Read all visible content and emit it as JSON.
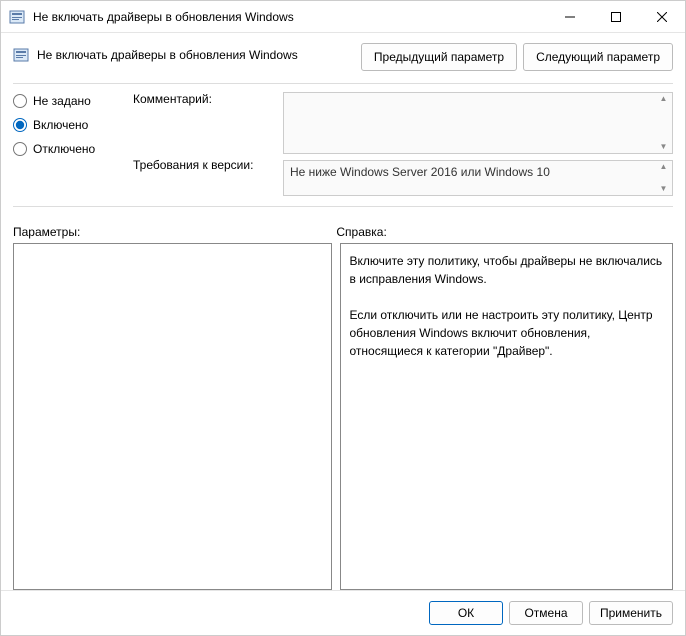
{
  "window": {
    "title": "Не включать драйверы в обновления Windows"
  },
  "policy": {
    "title": "Не включать драйверы в обновления Windows"
  },
  "nav": {
    "prev": "Предыдущий параметр",
    "next": "Следующий параметр"
  },
  "radios": {
    "not_configured": "Не задано",
    "enabled": "Включено",
    "disabled": "Отключено",
    "selected": "enabled"
  },
  "labels": {
    "comment": "Комментарий:",
    "requirements": "Требования к версии:",
    "options": "Параметры:",
    "help": "Справка:"
  },
  "comment_value": "",
  "requirements_value": "Не ниже Windows Server 2016 или Windows 10",
  "options_text": "",
  "help_text": "Включите эту политику, чтобы драйверы не включались в исправления Windows.\n\nЕсли отключить или не настроить эту политику, Центр обновления Windows включит обновления, относящиеся к категории \"Драйвер\".",
  "footer": {
    "ok": "ОК",
    "cancel": "Отмена",
    "apply": "Применить"
  }
}
